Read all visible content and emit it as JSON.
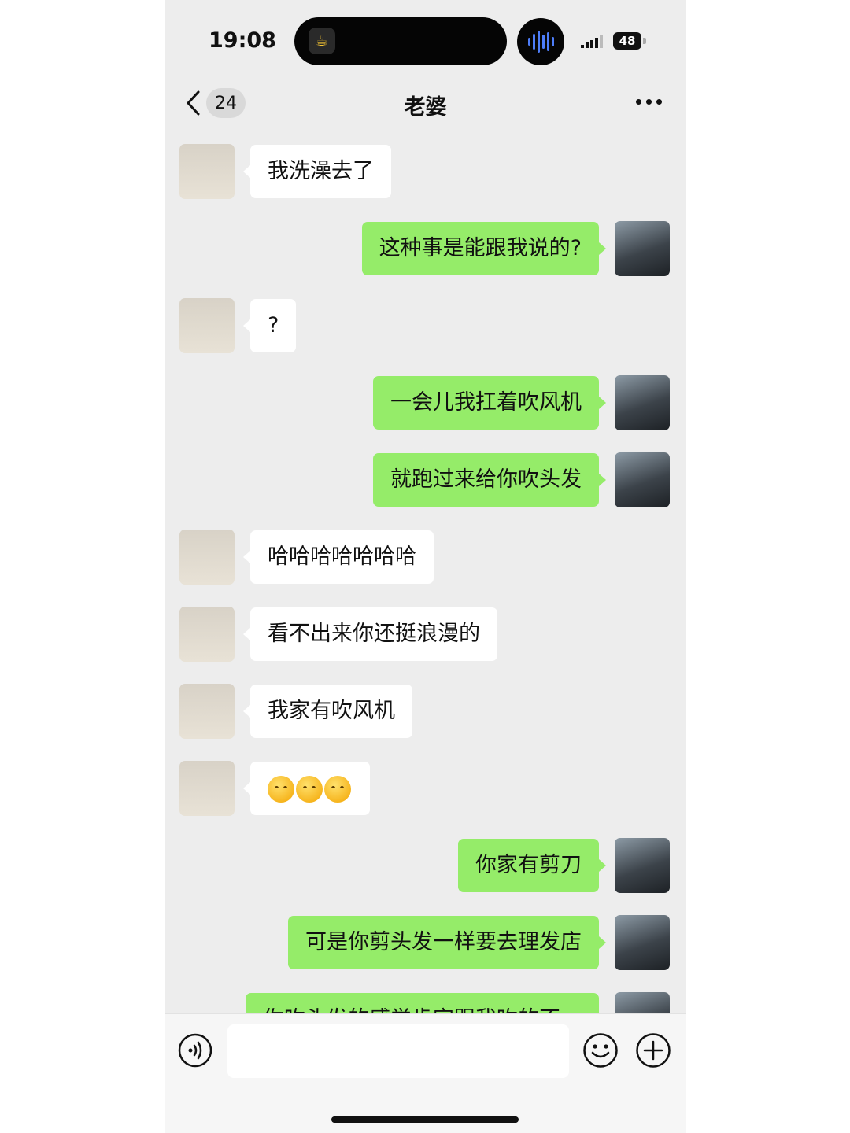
{
  "status_bar": {
    "time": "19:08",
    "battery": "48",
    "island_app_icon": "drink-app-icon",
    "audio_icon": "audio-wave-icon",
    "signal_icon": "cellular-signal-icon"
  },
  "nav": {
    "unread_count": "24",
    "title": "老婆",
    "back_icon": "chevron-left-icon",
    "more_icon": "more-dots-icon"
  },
  "messages": [
    {
      "side": "in",
      "text": "我洗澡去了"
    },
    {
      "side": "out",
      "text": "这种事是能跟我说的?"
    },
    {
      "side": "in",
      "text": "?"
    },
    {
      "side": "out",
      "text": "一会儿我扛着吹风机"
    },
    {
      "side": "out",
      "text": "就跑过来给你吹头发"
    },
    {
      "side": "in",
      "text": "哈哈哈哈哈哈哈"
    },
    {
      "side": "in",
      "text": "看不出来你还挺浪漫的"
    },
    {
      "side": "in",
      "text": "我家有吹风机"
    },
    {
      "side": "in",
      "emoji_count": 3,
      "emoji": "blush-emoji-icon"
    },
    {
      "side": "out",
      "text": "你家有剪刀"
    },
    {
      "side": "out",
      "text": "可是你剪头发一样要去理发店"
    },
    {
      "side": "out",
      "text": "你吹头发的感觉肯定跟我吹的不一"
    }
  ],
  "input_bar": {
    "value": "",
    "voice_icon": "voice-input-icon",
    "emoji_icon": "emoji-smile-icon",
    "plus_icon": "plus-circle-icon"
  },
  "colors": {
    "chat_background": "#ededed",
    "outgoing_bubble": "#95ec69",
    "incoming_bubble": "#ffffff"
  }
}
